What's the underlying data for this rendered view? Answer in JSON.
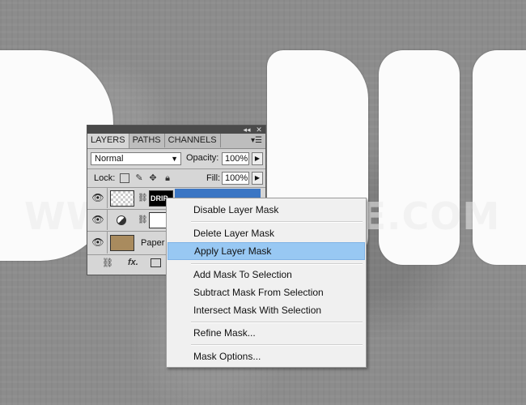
{
  "canvas": {
    "letters": "DRII",
    "watermark": "WWW.PSD-DUDE.COM"
  },
  "panel": {
    "tabs": [
      "LAYERS",
      "PATHS",
      "CHANNELS"
    ],
    "active_tab": "LAYERS",
    "blend_mode": "Normal",
    "opacity_label": "Opacity:",
    "opacity_value": "100%",
    "lock_label": "Lock:",
    "fill_label": "Fill:",
    "fill_value": "100%",
    "layers": [
      {
        "name": "",
        "mask_text": "DRIP",
        "selected": true
      },
      {
        "name": "",
        "selected": false
      },
      {
        "name": "Paper",
        "selected": false
      }
    ],
    "footer_icons": [
      "link-icon",
      "fx-icon",
      "mask-icon"
    ],
    "footer_fx": "fx."
  },
  "context_menu": {
    "items": [
      {
        "label": "Disable Layer Mask",
        "highlighted": false
      },
      {
        "label": "Delete Layer Mask",
        "highlighted": false
      },
      {
        "label": "Apply Layer Mask",
        "highlighted": true
      },
      {
        "label": "Add Mask To Selection",
        "highlighted": false
      },
      {
        "label": "Subtract Mask From Selection",
        "highlighted": false
      },
      {
        "label": "Intersect Mask With Selection",
        "highlighted": false
      },
      {
        "label": "Refine Mask...",
        "highlighted": false
      },
      {
        "label": "Mask Options...",
        "highlighted": false
      }
    ]
  },
  "colors": {
    "highlight": "#98c8f3",
    "selected_layer": "#3b76c4"
  }
}
